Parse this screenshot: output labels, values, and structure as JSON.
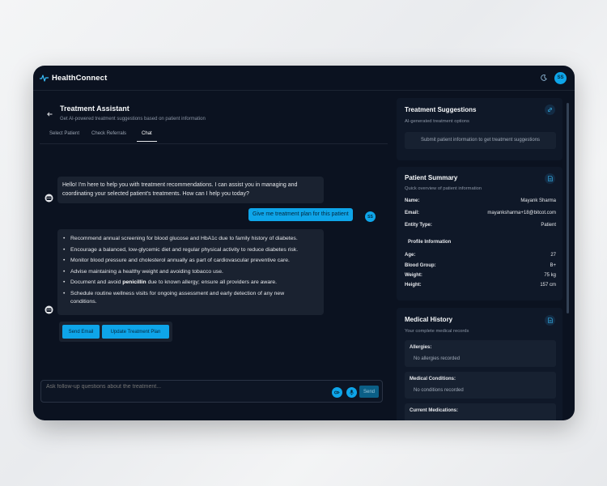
{
  "app": {
    "title": "HealthConnect",
    "user_initials": "SS"
  },
  "header": {
    "title": "Treatment Assistant",
    "subtitle": "Get AI-powered treatment suggestions based on patient information"
  },
  "tabs": [
    {
      "label": "Select Patient",
      "active": false
    },
    {
      "label": "Check Referrals",
      "active": false
    },
    {
      "label": "Chat",
      "active": true
    }
  ],
  "chat": {
    "bot_greeting_line1": "Hello! I'm here to help you with treatment recommendations. I can assist you in managing and",
    "bot_greeting_line2": "coordinating your selected patient's treatments. How can I help you today?",
    "user_message": "Give me treatment plan for this patient",
    "user_initials": "SS",
    "recommendations": {
      "r1": "Recommend annual screening for blood glucose and HbA1c due to family history of diabetes.",
      "r2": "Encourage a balanced, low-glycemic diet and regular physical activity to reduce diabetes risk.",
      "r3": "Monitor blood pressure and cholesterol annually as part of cardiovascular preventive care.",
      "r4": "Advise maintaining a healthy weight and avoiding tobacco use.",
      "r5_pre": "Document and avoid ",
      "r5_bold": "penicillin",
      "r5_post": " due to known allergy; ensure all providers are aware.",
      "r6_line1": "Schedule routine wellness visits for ongoing assessment and early detection of any new",
      "r6_line2": "conditions."
    },
    "actions": {
      "send_email": "Send Email",
      "update_plan": "Update Treatment Plan"
    }
  },
  "composer": {
    "placeholder": "Ask follow-up questions about the treatment...",
    "send_label": "Send",
    "icon1_label": "O",
    "icon2_label": "●"
  },
  "treatment_suggestions": {
    "title": "Treatment Suggestions",
    "subtitle": "AI-generated treatment options",
    "empty_text": "Submit patient information to get treatment suggestions"
  },
  "patient_summary": {
    "title": "Patient Summary",
    "subtitle": "Quick overview of patient information",
    "name_label": "Name:",
    "name_value": "Mayank Sharma",
    "email_label": "Email:",
    "email_value": "mayanksharma+18@bitcot.com",
    "entity_label": "Entity Type:",
    "entity_value": "Patient",
    "profile_label": "Profile Information",
    "age_label": "Age:",
    "age_value": "27",
    "blood_label": "Blood Group:",
    "blood_value": "B+",
    "weight_label": "Weight:",
    "weight_value": "75 kg",
    "height_label": "Height:",
    "height_value": "157 cm"
  },
  "medical_history": {
    "title": "Medical History",
    "subtitle": "Your complete medical records",
    "allergies_label": "Allergies:",
    "allergies_value": "No allergies recorded",
    "conditions_label": "Medical Conditions:",
    "conditions_value": "No conditions recorded",
    "meds_label": "Current Medications:"
  }
}
